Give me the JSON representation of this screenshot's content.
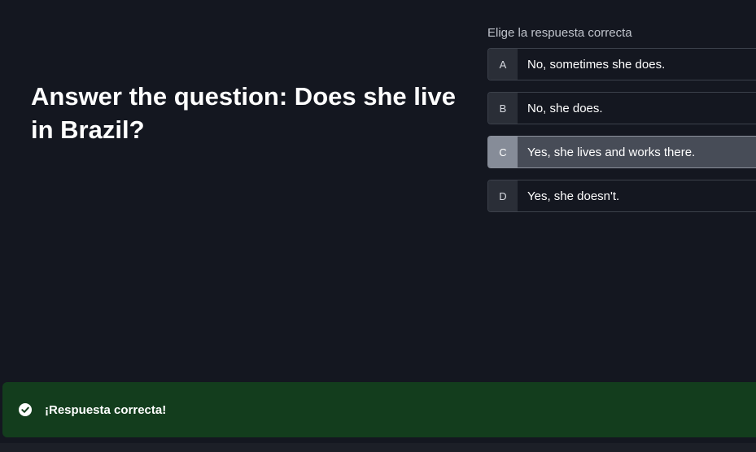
{
  "question": {
    "text": "Answer the question: Does she live in Brazil?"
  },
  "answers": {
    "instruction": "Elige la respuesta correcta",
    "options": [
      {
        "key": "A",
        "text": "No, sometimes she does."
      },
      {
        "key": "B",
        "text": "No, she does."
      },
      {
        "key": "C",
        "text": "Yes, she lives and works there.",
        "selected": true
      },
      {
        "key": "D",
        "text": "Yes, she doesn't."
      }
    ]
  },
  "feedback": {
    "icon": "check-circle-icon",
    "message": "¡Respuesta correcta!",
    "color": "#133d1d"
  },
  "colors": {
    "background": "#141720",
    "selected_option": "#474c57"
  }
}
